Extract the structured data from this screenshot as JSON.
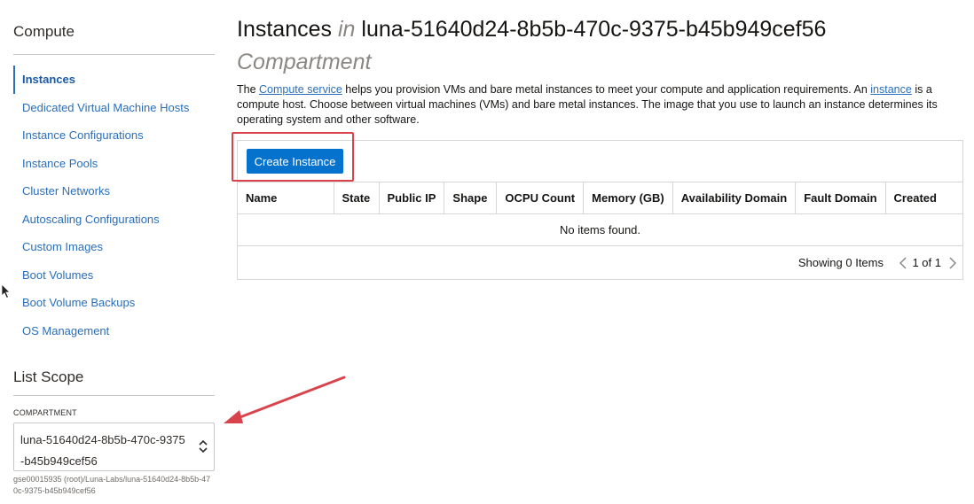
{
  "sidebar": {
    "heading": "Compute",
    "items": [
      {
        "label": "Instances",
        "active": true
      },
      {
        "label": "Dedicated Virtual Machine Hosts"
      },
      {
        "label": "Instance Configurations"
      },
      {
        "label": "Instance Pools"
      },
      {
        "label": "Cluster Networks"
      },
      {
        "label": "Autoscaling Configurations"
      },
      {
        "label": "Custom Images"
      },
      {
        "label": "Boot Volumes"
      },
      {
        "label": "Boot Volume Backups"
      },
      {
        "label": "OS Management"
      }
    ],
    "list_scope": {
      "heading": "List Scope",
      "compartment_label": "COMPARTMENT",
      "compartment_value": "luna-51640d24-8b5b-470c-9375-b45b949cef56",
      "compartment_path": "gse00015935 (root)/Luna-Labs/luna-51640d24-8b5b-470c-9375-b45b949cef56"
    }
  },
  "header": {
    "title": "Instances",
    "title_in": "in",
    "title_compartment": "luna-51640d24-8b5b-470c-9375-b45b949cef56",
    "subtitle": "Compartment"
  },
  "description": {
    "part1": "The ",
    "link1": "Compute service",
    "part2": " helps you provision VMs and bare metal instances to meet your compute and application requirements. An ",
    "link2": "instance",
    "part3": " is a compute host. Choose between virtual machines (VMs) and bare metal instances. The image that you use to launch an instance determines its operating system and other software."
  },
  "toolbar": {
    "create_label": "Create Instance"
  },
  "table": {
    "columns": [
      "Name",
      "State",
      "Public IP",
      "Shape",
      "OCPU Count",
      "Memory (GB)",
      "Availability Domain",
      "Fault Domain",
      "Created"
    ],
    "empty_text": "No items found."
  },
  "footer": {
    "showing": "Showing 0 Items",
    "page_text": "1 of 1"
  },
  "colors": {
    "link": "#2a6ebb",
    "primary_button": "#0572ce",
    "annotation_red": "#d9434b"
  }
}
